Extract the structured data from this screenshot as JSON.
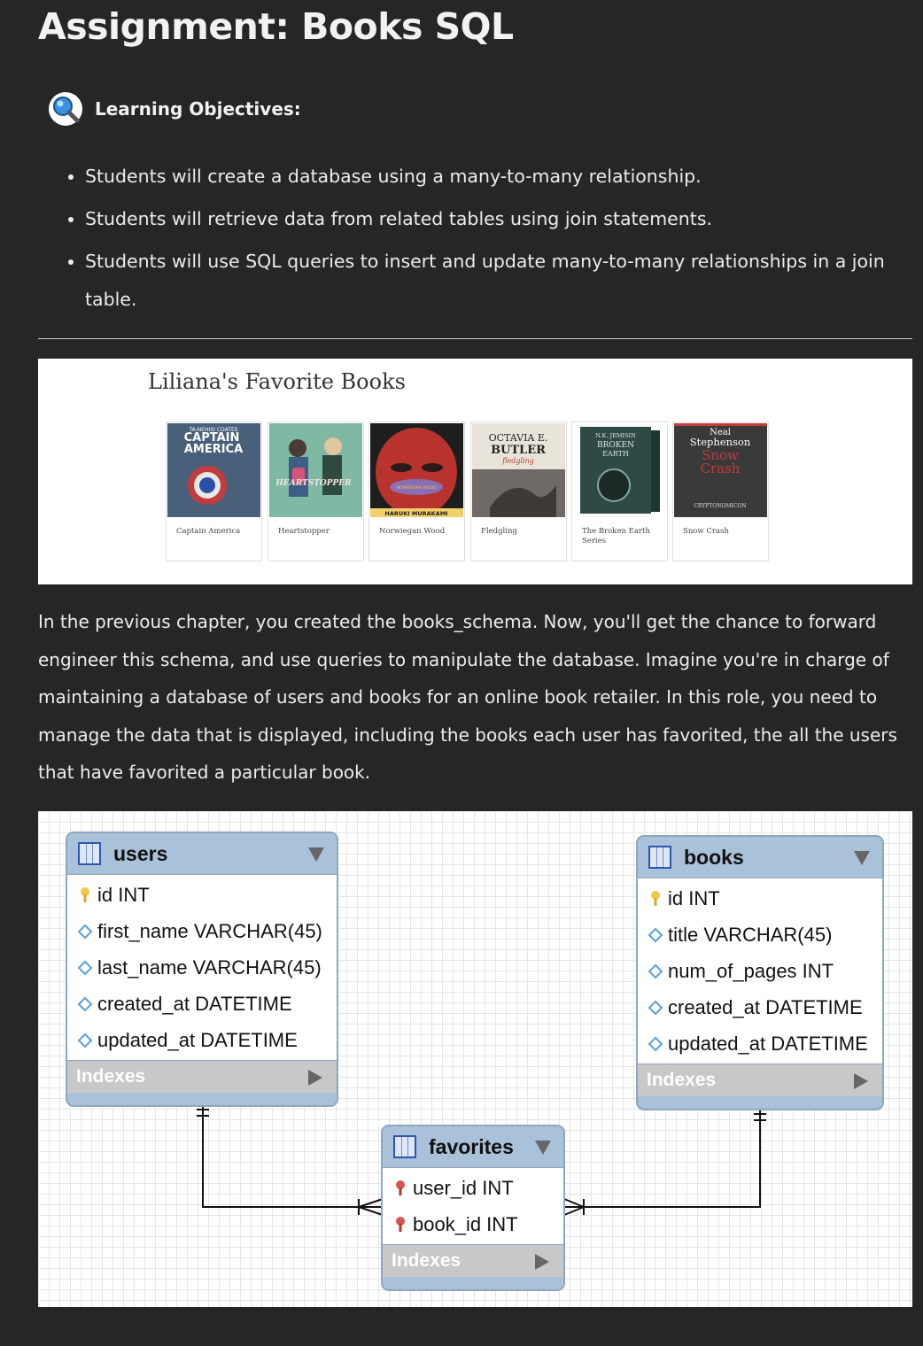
{
  "page": {
    "title": "Assignment: Books SQL"
  },
  "objectives": {
    "heading": "Learning Objectives:",
    "icon": "magnifying-glass-icon",
    "items": [
      "Students will create a database using a many-to-many relationship.",
      "Students will retrieve data from related tables using join statements.",
      "Students will use SQL queries to insert and update many-to-many relationships in a join table."
    ]
  },
  "favorites_panel": {
    "title": "Liliana's Favorite Books",
    "books": [
      {
        "name": "Captain America",
        "cover_text": [
          "TA-NEHISI COATES",
          "CAPTAIN",
          "AMERICA"
        ],
        "color": "#4a5f7a"
      },
      {
        "name": "Heartstopper",
        "cover_text": [
          "HEARTSTOPPER"
        ],
        "color": "#7fb8a3"
      },
      {
        "name": "Norwiegan Wood",
        "cover_text": [
          "NORWEGIAN WOOD",
          "HARUKI MURAKAMI"
        ],
        "color": "#b8332d"
      },
      {
        "name": "Fledgling",
        "cover_text": [
          "OCTAVIA E.",
          "BUTLER",
          "fledgling"
        ],
        "color": "#e9e4da"
      },
      {
        "name": "The Broken Earth Series",
        "cover_text": [
          "N.K. JEMISIN",
          "BROKEN",
          "EARTH"
        ],
        "color": "#2f4a44"
      },
      {
        "name": "Snow Crash",
        "cover_text": [
          "Neal",
          "Stephenson",
          "Snow",
          "Crash",
          "CRYPTONOMICON"
        ],
        "color": "#3a3a3a"
      }
    ]
  },
  "intro": {
    "text": "In the previous chapter, you created the books_schema. Now, you'll get the chance to forward engineer this schema, and use queries to manipulate the database. Imagine you're in charge of maintaining a database of users and books for an online book retailer. In this role, you need to manage the data that is displayed, including the books each user has favorited, the all the users that have favorited a particular book."
  },
  "erd": {
    "indexes_label": "Indexes",
    "tables": {
      "users": {
        "name": "users",
        "columns": [
          {
            "text": "id INT",
            "kind": "primary-key"
          },
          {
            "text": "first_name VARCHAR(45)",
            "kind": "column"
          },
          {
            "text": "last_name VARCHAR(45)",
            "kind": "column"
          },
          {
            "text": "created_at DATETIME",
            "kind": "column"
          },
          {
            "text": "updated_at DATETIME",
            "kind": "column"
          }
        ]
      },
      "books": {
        "name": "books",
        "columns": [
          {
            "text": "id INT",
            "kind": "primary-key"
          },
          {
            "text": "title VARCHAR(45)",
            "kind": "column"
          },
          {
            "text": "num_of_pages INT",
            "kind": "column"
          },
          {
            "text": "created_at DATETIME",
            "kind": "column"
          },
          {
            "text": "updated_at DATETIME",
            "kind": "column"
          }
        ]
      },
      "favorites": {
        "name": "favorites",
        "columns": [
          {
            "text": "user_id INT",
            "kind": "foreign-key"
          },
          {
            "text": "book_id INT",
            "kind": "foreign-key"
          }
        ]
      }
    },
    "relationships": [
      {
        "from": "users",
        "to": "favorites",
        "type": "one-to-many"
      },
      {
        "from": "books",
        "to": "favorites",
        "type": "one-to-many"
      }
    ]
  }
}
